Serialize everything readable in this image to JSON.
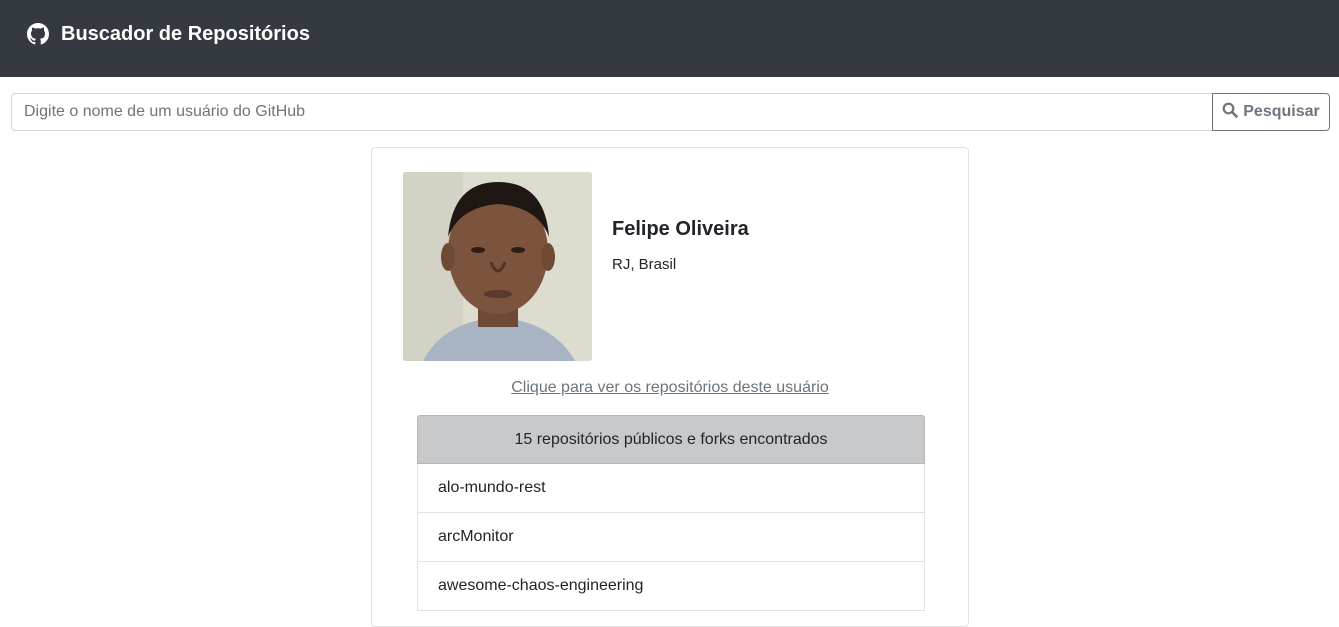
{
  "header": {
    "title": "Buscador de Repositórios",
    "icon": "github-icon"
  },
  "search": {
    "placeholder": "Digite o nome de um usuário do GitHub",
    "value": "",
    "button_label": "Pesquisar",
    "button_icon": "search-icon"
  },
  "profile": {
    "name": "Felipe Oliveira",
    "location": "RJ, Brasil",
    "repos_link": "Clique para ver os repositórios deste usuário"
  },
  "repositories": {
    "header": "15 repositórios públicos e forks encontrados",
    "items": [
      "alo-mundo-rest",
      "arcMonitor",
      "awesome-chaos-engineering"
    ]
  },
  "colors": {
    "navbar": "#343a40",
    "list_header": "#c8c9cb",
    "secondary": "#6c757d"
  }
}
